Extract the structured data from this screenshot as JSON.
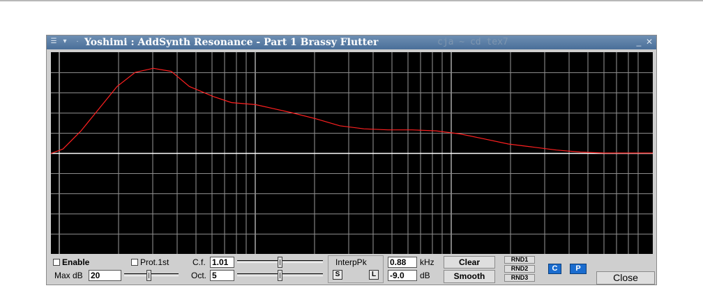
{
  "window": {
    "title": "Yoshimi : AddSynth Resonance - Part 1 Brassy Flutter",
    "background_ghost_text": "cja ~ cd tex7"
  },
  "graph": {
    "background": "#000000",
    "grid_color": "#ffffff",
    "curve_color": "#ff2020",
    "curve": [
      [
        0.0,
        0.502
      ],
      [
        0.02,
        0.48
      ],
      [
        0.05,
        0.39
      ],
      [
        0.08,
        0.28
      ],
      [
        0.11,
        0.17
      ],
      [
        0.14,
        0.1
      ],
      [
        0.17,
        0.08
      ],
      [
        0.2,
        0.095
      ],
      [
        0.23,
        0.17
      ],
      [
        0.27,
        0.22
      ],
      [
        0.3,
        0.25
      ],
      [
        0.34,
        0.26
      ],
      [
        0.37,
        0.28
      ],
      [
        0.4,
        0.3
      ],
      [
        0.44,
        0.33
      ],
      [
        0.48,
        0.365
      ],
      [
        0.52,
        0.38
      ],
      [
        0.56,
        0.385
      ],
      [
        0.6,
        0.385
      ],
      [
        0.64,
        0.39
      ],
      [
        0.68,
        0.405
      ],
      [
        0.72,
        0.43
      ],
      [
        0.76,
        0.455
      ],
      [
        0.8,
        0.47
      ],
      [
        0.84,
        0.485
      ],
      [
        0.88,
        0.495
      ],
      [
        0.92,
        0.5
      ],
      [
        1.0,
        0.5
      ]
    ]
  },
  "controls": {
    "enable_label": "Enable",
    "enable_checked": false,
    "prot1st_label": "Prot.1st",
    "prot1st_checked": false,
    "maxdb_label": "Max dB",
    "maxdb_value": "20",
    "maxdb_slider_position": 0.45,
    "cf_label": "C.f.",
    "cf_value": "1.01",
    "cf_slider_position": 0.5,
    "oct_label": "Oct.",
    "oct_value": "5",
    "oct_slider_position": 0.5,
    "interppk_label": "InterpPk",
    "interp_s_label": "S",
    "interp_l_label": "L",
    "khz_value": "0.88",
    "khz_unit": "kHz",
    "db_value": "-9.0",
    "db_unit": "dB",
    "clear_label": "Clear",
    "smooth_label": "Smooth",
    "rnd1_label": "RND1",
    "rnd2_label": "RND2",
    "rnd3_label": "RND3",
    "c_label": "C",
    "p_label": "P",
    "close_label": "Close"
  },
  "colors": {
    "titlebar": "#5a7da6",
    "accent_blue": "#1a6ccf",
    "window_bg": "#cfcfcf"
  }
}
